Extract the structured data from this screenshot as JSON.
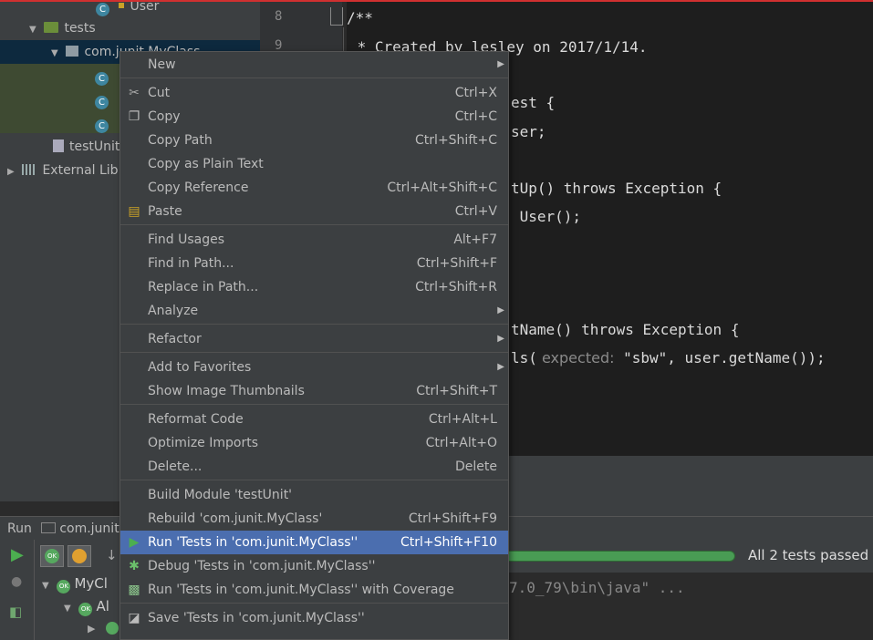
{
  "project_tree": {
    "user_item": "User",
    "tests_folder": "tests",
    "package": "com.junit.MyClass",
    "test_unit": "testUnit",
    "external_libs": "External Lib"
  },
  "gutter": {
    "line_8": "8",
    "line_9": "9"
  },
  "editor": {
    "line_8": "/**",
    "line_9": " * Created by lesley on 2017/1/14.",
    "frag_1": "est {",
    "frag_2": "ser;",
    "frag_3": "tUp() throws Exception {",
    "frag_4": " User();",
    "frag_5": "tName() throws Exception {",
    "frag_6_pre": "ls(",
    "frag_6_hint": " expected:",
    "frag_6_post": " \"sbw\", user.getName());"
  },
  "run_panel": {
    "run_label": "Run",
    "config_name": "com.junit.l",
    "status": "All 2 tests passed -",
    "tree_root": "MyCl",
    "tree_child": "Al",
    "console_line": "7.0_79\\bin\\java\" ..."
  },
  "context_menu": {
    "items": [
      {
        "label": "New",
        "shortcut": "",
        "submenu": true
      },
      {
        "label": "Cut",
        "shortcut": "Ctrl+X"
      },
      {
        "label": "Copy",
        "shortcut": "Ctrl+C"
      },
      {
        "label": "Copy Path",
        "shortcut": "Ctrl+Shift+C"
      },
      {
        "label": "Copy as Plain Text",
        "shortcut": ""
      },
      {
        "label": "Copy Reference",
        "shortcut": "Ctrl+Alt+Shift+C"
      },
      {
        "label": "Paste",
        "shortcut": "Ctrl+V"
      },
      {
        "label": "Find Usages",
        "shortcut": "Alt+F7"
      },
      {
        "label": "Find in Path...",
        "shortcut": "Ctrl+Shift+F"
      },
      {
        "label": "Replace in Path...",
        "shortcut": "Ctrl+Shift+R"
      },
      {
        "label": "Analyze",
        "shortcut": "",
        "submenu": true
      },
      {
        "label": "Refactor",
        "shortcut": "",
        "submenu": true
      },
      {
        "label": "Add to Favorites",
        "shortcut": "",
        "submenu": true
      },
      {
        "label": "Show Image Thumbnails",
        "shortcut": "Ctrl+Shift+T"
      },
      {
        "label": "Reformat Code",
        "shortcut": "Ctrl+Alt+L"
      },
      {
        "label": "Optimize Imports",
        "shortcut": "Ctrl+Alt+O"
      },
      {
        "label": "Delete...",
        "shortcut": "Delete"
      },
      {
        "label": "Build Module 'testUnit'",
        "shortcut": ""
      },
      {
        "label": "Rebuild 'com.junit.MyClass'",
        "shortcut": "Ctrl+Shift+F9"
      },
      {
        "label": "Run 'Tests in 'com.junit.MyClass''",
        "shortcut": "Ctrl+Shift+F10",
        "active": true
      },
      {
        "label": "Debug 'Tests in 'com.junit.MyClass''",
        "shortcut": ""
      },
      {
        "label": "Run 'Tests in 'com.junit.MyClass'' with Coverage",
        "shortcut": ""
      },
      {
        "label": "Save 'Tests in 'com.junit.MyClass''",
        "shortcut": ""
      }
    ]
  },
  "icons": {
    "cut": "scissors-icon",
    "copy": "copy-icon",
    "paste": "paste-icon",
    "run": "run-play-icon",
    "debug": "debug-bug-icon",
    "coverage": "coverage-icon",
    "save": "save-icon"
  },
  "colors": {
    "selection": "#4b6eaf",
    "run_green": "#499c54",
    "error_red": "#d03030"
  }
}
